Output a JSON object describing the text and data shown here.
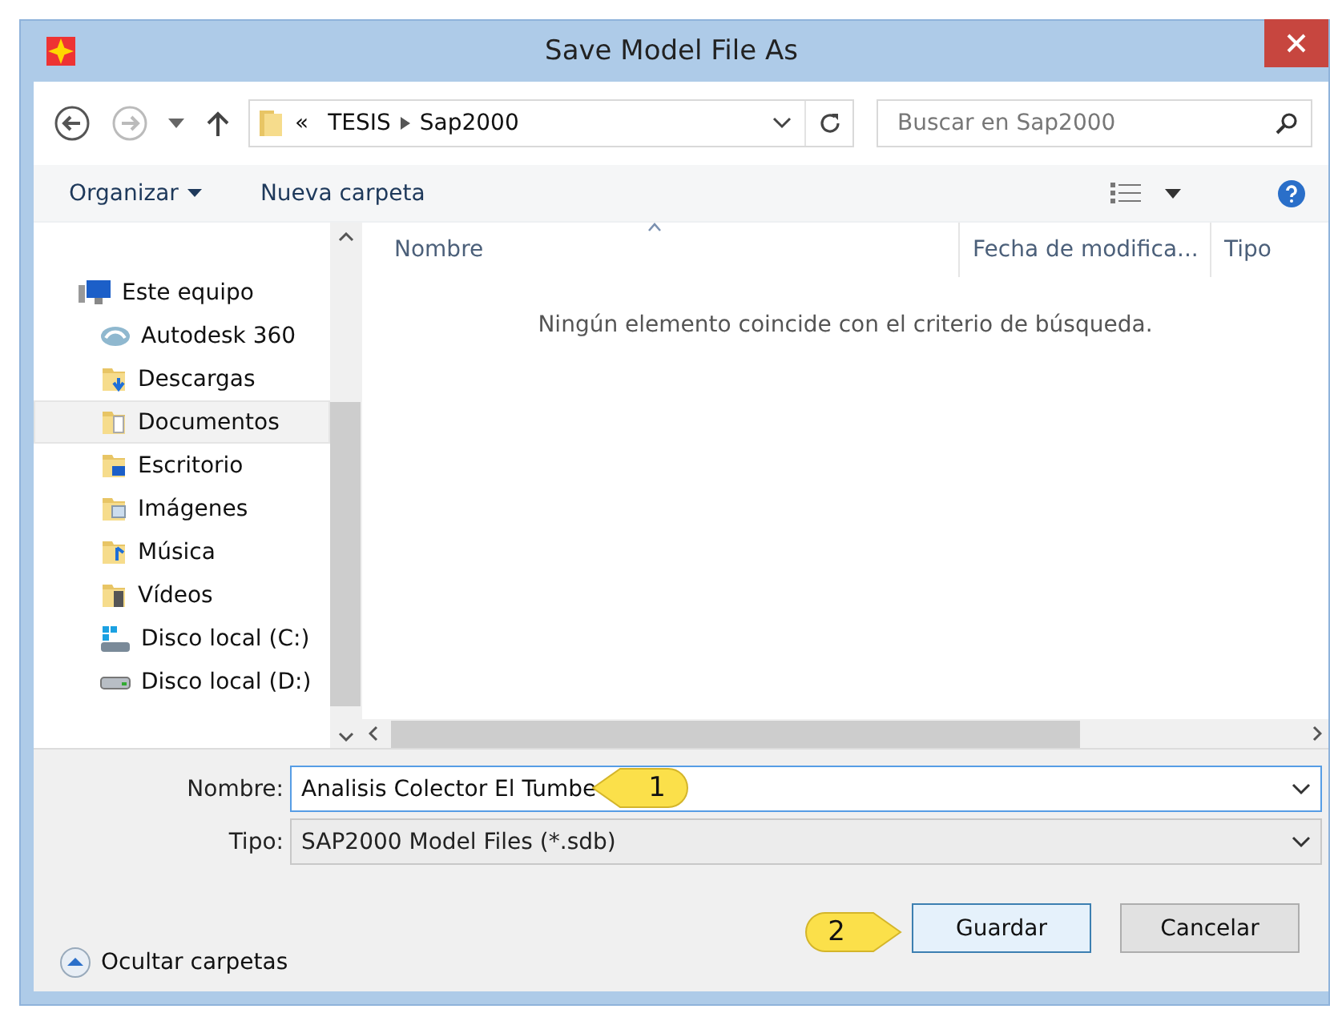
{
  "window": {
    "title": "Save Model File As"
  },
  "address": {
    "overflow": "«",
    "segments": [
      "TESIS",
      "Sap2000"
    ]
  },
  "search": {
    "placeholder": "Buscar en Sap2000"
  },
  "toolbar": {
    "organize": "Organizar",
    "new_folder": "Nueva carpeta"
  },
  "sidebar": {
    "items": [
      {
        "label": "Este equipo",
        "kind": "computer",
        "selected": false,
        "children": [
          {
            "label": "Autodesk 360",
            "kind": "cloud",
            "selected": false
          },
          {
            "label": "Descargas",
            "kind": "downloads",
            "selected": false
          },
          {
            "label": "Documentos",
            "kind": "documents",
            "selected": true
          },
          {
            "label": "Escritorio",
            "kind": "desktop",
            "selected": false
          },
          {
            "label": "Imágenes",
            "kind": "pictures",
            "selected": false
          },
          {
            "label": "Música",
            "kind": "music",
            "selected": false
          },
          {
            "label": "Vídeos",
            "kind": "videos",
            "selected": false
          },
          {
            "label": "Disco local (C:)",
            "kind": "system-drive",
            "selected": false
          },
          {
            "label": "Disco local (D:)",
            "kind": "drive",
            "selected": false
          }
        ]
      }
    ]
  },
  "file_list": {
    "columns": [
      {
        "label": "Nombre",
        "sorted": true
      },
      {
        "label": "Fecha de modifica...",
        "sorted": false
      },
      {
        "label": "Tipo",
        "sorted": false
      }
    ],
    "empty_message": "Ningún elemento coincide con el criterio de búsqueda."
  },
  "form": {
    "fields": [
      {
        "label": "Nombre:",
        "value": "Analisis Colector El Tumbe",
        "kind": "combo-input"
      },
      {
        "label": "Tipo:",
        "value": "SAP2000 Model Files (*.sdb)",
        "kind": "select"
      }
    ]
  },
  "footer": {
    "toggle": "Ocultar carpetas",
    "buttons": [
      {
        "label": "Guardar",
        "default": true
      },
      {
        "label": "Cancelar",
        "default": false
      }
    ]
  },
  "callouts": [
    {
      "number": "1"
    },
    {
      "number": "2"
    }
  ]
}
